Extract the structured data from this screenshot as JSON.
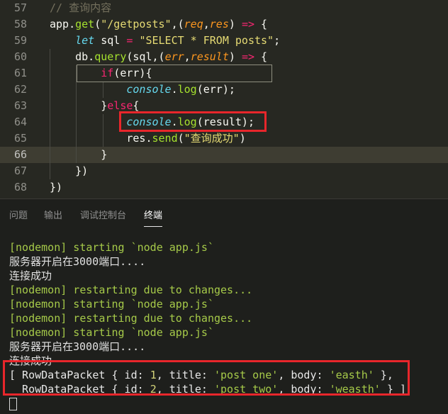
{
  "editor": {
    "lines": [
      {
        "num": "57",
        "parts": [
          {
            "t": "// 查询内容",
            "c": "cm"
          }
        ]
      },
      {
        "num": "58",
        "parts": [
          {
            "t": "app.",
            "c": ""
          },
          {
            "t": "get",
            "c": "fn"
          },
          {
            "t": "(",
            "c": ""
          },
          {
            "t": "\"/getposts\"",
            "c": "st"
          },
          {
            "t": ",(",
            "c": ""
          },
          {
            "t": "req",
            "c": "it"
          },
          {
            "t": ",",
            "c": ""
          },
          {
            "t": "res",
            "c": "it"
          },
          {
            "t": ") ",
            "c": ""
          },
          {
            "t": "=>",
            "c": "kw"
          },
          {
            "t": " {",
            "c": ""
          }
        ]
      },
      {
        "num": "59",
        "parts": [
          {
            "t": "    ",
            "c": ""
          },
          {
            "t": "let",
            "c": "cl"
          },
          {
            "t": " sql ",
            "c": ""
          },
          {
            "t": "=",
            "c": "kw"
          },
          {
            "t": " ",
            "c": ""
          },
          {
            "t": "\"SELECT * FROM posts\"",
            "c": "st"
          },
          {
            "t": ";",
            "c": ""
          }
        ]
      },
      {
        "num": "60",
        "parts": [
          {
            "t": "    db.",
            "c": ""
          },
          {
            "t": "query",
            "c": "fn"
          },
          {
            "t": "(sql,(",
            "c": ""
          },
          {
            "t": "err",
            "c": "it"
          },
          {
            "t": ",",
            "c": ""
          },
          {
            "t": "result",
            "c": "it"
          },
          {
            "t": ") ",
            "c": ""
          },
          {
            "t": "=>",
            "c": "kw"
          },
          {
            "t": " {",
            "c": ""
          }
        ]
      },
      {
        "num": "61",
        "parts": [
          {
            "t": "        ",
            "c": ""
          },
          {
            "t": "if",
            "c": "kw"
          },
          {
            "t": "(err){",
            "c": ""
          }
        ]
      },
      {
        "num": "62",
        "parts": [
          {
            "t": "            ",
            "c": ""
          },
          {
            "t": "console",
            "c": "cl"
          },
          {
            "t": ".",
            "c": ""
          },
          {
            "t": "log",
            "c": "fn"
          },
          {
            "t": "(err);",
            "c": ""
          }
        ]
      },
      {
        "num": "63",
        "parts": [
          {
            "t": "        }",
            "c": ""
          },
          {
            "t": "else",
            "c": "kw"
          },
          {
            "t": "{",
            "c": ""
          }
        ]
      },
      {
        "num": "64",
        "parts": [
          {
            "t": "            ",
            "c": ""
          },
          {
            "t": "console",
            "c": "cl"
          },
          {
            "t": ".",
            "c": ""
          },
          {
            "t": "log",
            "c": "fn"
          },
          {
            "t": "(result);",
            "c": ""
          }
        ]
      },
      {
        "num": "65",
        "parts": [
          {
            "t": "            res.",
            "c": ""
          },
          {
            "t": "send",
            "c": "fn"
          },
          {
            "t": "(",
            "c": ""
          },
          {
            "t": "\"查询成功\"",
            "c": "st"
          },
          {
            "t": ")",
            "c": ""
          }
        ]
      },
      {
        "num": "66",
        "parts": [
          {
            "t": "        }",
            "c": ""
          }
        ]
      },
      {
        "num": "67",
        "parts": [
          {
            "t": "    })",
            "c": ""
          }
        ]
      },
      {
        "num": "68",
        "parts": [
          {
            "t": "})",
            "c": ""
          }
        ]
      }
    ],
    "active_line": "66"
  },
  "panel": {
    "tabs": [
      {
        "label": "问题",
        "active": false
      },
      {
        "label": "输出",
        "active": false
      },
      {
        "label": "调试控制台",
        "active": false
      },
      {
        "label": "终端",
        "active": true
      }
    ]
  },
  "terminal": {
    "lines": [
      {
        "text": "[nodemon] starting `node app.js`",
        "style": "green"
      },
      {
        "text": "服务器开启在3000端口....",
        "style": "out"
      },
      {
        "text": "连接成功",
        "style": "out"
      },
      {
        "text": "[nodemon] restarting due to changes...",
        "style": "green"
      },
      {
        "text": "[nodemon] starting `node app.js`",
        "style": "green"
      },
      {
        "text": "[nodemon] restarting due to changes...",
        "style": "green"
      },
      {
        "text": "[nodemon] starting `node app.js`",
        "style": "green"
      },
      {
        "text": "服务器开启在3000端口....",
        "style": "out"
      },
      {
        "text": "连接成功",
        "style": "out"
      }
    ],
    "result": [
      [
        {
          "t": "[ RowDataPacket { id: ",
          "c": ""
        },
        {
          "t": "1",
          "c": "num"
        },
        {
          "t": ", title: ",
          "c": ""
        },
        {
          "t": "'post one'",
          "c": "str"
        },
        {
          "t": ", body: ",
          "c": ""
        },
        {
          "t": "'easth'",
          "c": "str"
        },
        {
          "t": " },",
          "c": ""
        }
      ],
      [
        {
          "t": "  RowDataPacket { id: ",
          "c": ""
        },
        {
          "t": "2",
          "c": "num"
        },
        {
          "t": ", title: ",
          "c": ""
        },
        {
          "t": "'post two'",
          "c": "str"
        },
        {
          "t": ", body: ",
          "c": ""
        },
        {
          "t": "'weasth'",
          "c": "str"
        },
        {
          "t": " } ]",
          "c": ""
        }
      ]
    ]
  }
}
